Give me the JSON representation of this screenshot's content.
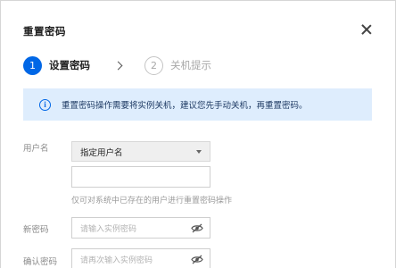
{
  "dialog": {
    "title": "重置密码"
  },
  "steps": [
    {
      "number": "1",
      "label": "设置密码",
      "state": "active"
    },
    {
      "number": "2",
      "label": "关机提示",
      "state": "inactive"
    }
  ],
  "notice": {
    "text": "重置密码操作需要将实例关机，建议您先手动关机，再重置密码。",
    "icon": "info-icon"
  },
  "form": {
    "username_label": "用户名",
    "username_select_value": "指定用户名",
    "username_input_value": "",
    "username_hint": "仅可对系统中已存在的用户进行重置密码操作",
    "new_password_label": "新密码",
    "new_password_placeholder": "请输入实例密码",
    "confirm_password_label": "确认密码",
    "confirm_password_placeholder": "请再次输入实例密码"
  },
  "colors": {
    "accent": "#0067e6",
    "notice_bg": "#deedfd"
  }
}
